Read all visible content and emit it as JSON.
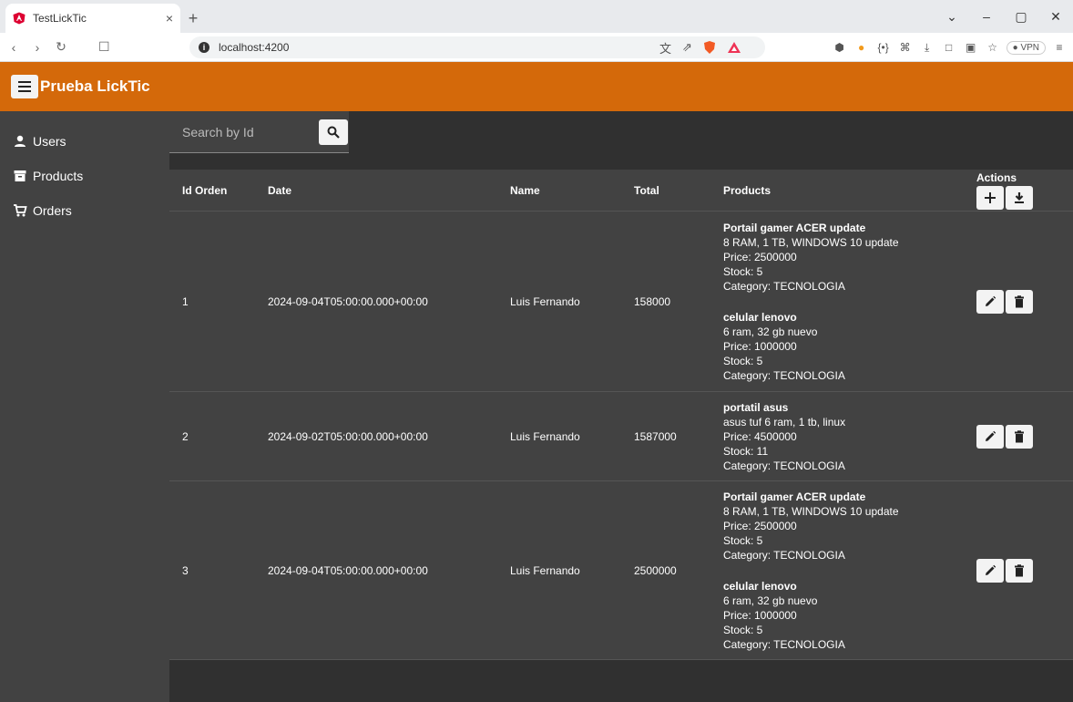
{
  "browser": {
    "tab_title": "TestLickTic",
    "tab_close": "×",
    "new_tab": "+",
    "url": "localhost:4200",
    "vpn_label": "VPN",
    "window_controls": [
      "⌄",
      "–",
      "▢",
      "✕"
    ]
  },
  "app": {
    "title": "Prueba LickTic",
    "colors": {
      "header": "#d4690a",
      "sidebar": "#424242",
      "background": "#303030"
    }
  },
  "sidebar": {
    "items": [
      {
        "label": "Users",
        "icon": "person-icon"
      },
      {
        "label": "Products",
        "icon": "archive-icon"
      },
      {
        "label": "Orders",
        "icon": "cart-icon"
      }
    ]
  },
  "search": {
    "placeholder": "Search by Id"
  },
  "table": {
    "headers": {
      "id": "Id Orden",
      "date": "Date",
      "name": "Name",
      "total": "Total",
      "products": "Products",
      "actions": "Actions"
    },
    "rows": [
      {
        "id": "1",
        "date": "2024-09-04T05:00:00.000+00:00",
        "name": "Luis Fernando",
        "total": "158000",
        "products": [
          {
            "name": "Portail gamer ACER update",
            "desc": "8 RAM, 1 TB, WINDOWS 10 update",
            "price": "Price: 2500000",
            "stock": "Stock: 5",
            "category": "Category: TECNOLOGIA"
          },
          {
            "name": "celular lenovo",
            "desc": "6 ram, 32 gb nuevo",
            "price": "Price: 1000000",
            "stock": "Stock: 5",
            "category": "Category: TECNOLOGIA"
          }
        ]
      },
      {
        "id": "2",
        "date": "2024-09-02T05:00:00.000+00:00",
        "name": "Luis Fernando",
        "total": "1587000",
        "products": [
          {
            "name": "portatil asus",
            "desc": "asus tuf 6 ram, 1 tb, linux",
            "price": "Price: 4500000",
            "stock": "Stock: 11",
            "category": "Category: TECNOLOGIA"
          }
        ]
      },
      {
        "id": "3",
        "date": "2024-09-04T05:00:00.000+00:00",
        "name": "Luis Fernando",
        "total": "2500000",
        "products": [
          {
            "name": "Portail gamer ACER update",
            "desc": "8 RAM, 1 TB, WINDOWS 10 update",
            "price": "Price: 2500000",
            "stock": "Stock: 5",
            "category": "Category: TECNOLOGIA"
          },
          {
            "name": "celular lenovo",
            "desc": "6 ram, 32 gb nuevo",
            "price": "Price: 1000000",
            "stock": "Stock: 5",
            "category": "Category: TECNOLOGIA"
          }
        ]
      }
    ]
  }
}
